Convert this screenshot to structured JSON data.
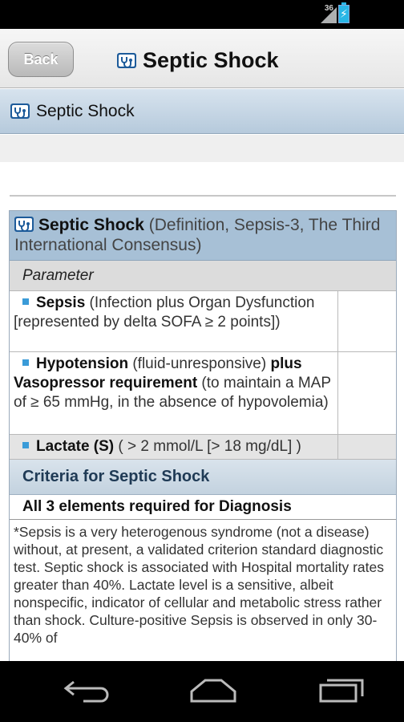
{
  "status_bar": {
    "network_type": "36",
    "icons": [
      "signal-icon",
      "battery-charging-icon"
    ]
  },
  "header": {
    "back_label": "Back",
    "title": "Septic Shock",
    "title_icon": "stethoscope-icon"
  },
  "subheader": {
    "title": "Septic Shock"
  },
  "table": {
    "title_bold": "Septic Shock",
    "title_light": " (Definition, Sepsis-3, The Third International Consensus)",
    "parameter_label": "Parameter",
    "rows": [
      {
        "name": "Sepsis",
        "detail": " (Infection plus Organ Dysfunction [represented by delta SOFA ≥ 2 points])"
      },
      {
        "name": "Hypotension",
        "detail1": " (fluid-unresponsive) ",
        "name2": "plus Vasopressor requirement",
        "detail2": " (to maintain a MAP of ≥ 65 mmHg, in the absence of hypovolemia)"
      },
      {
        "name": "Lactate (S)",
        "detail": " ( > 2 mmol/L [> 18 mg/dL] )"
      }
    ],
    "criteria_title": "Criteria for Septic Shock",
    "criteria_requirement": "All 3 elements required for Diagnosis",
    "notes": "*Sepsis is a very heterogenous syndrome (not a disease) without, at present, a validated criterion standard diagnostic test. Septic shock is associated with Hospital mortality rates greater than 40%. Lactate level is a sensitive, albeit nonspecific, indicator of cellular and metabolic stress rather than shock. Culture-positive Sepsis is observed in only 30-40% of"
  },
  "nav": {
    "icons": [
      "back-arrow-icon",
      "home-icon",
      "recent-apps-icon"
    ]
  },
  "colors": {
    "subheader_bg": "#b6cadc",
    "table_header_bg": "#a7c0d6",
    "bullet": "#3a9bd8",
    "icon_blue": "#1d5b9a"
  }
}
